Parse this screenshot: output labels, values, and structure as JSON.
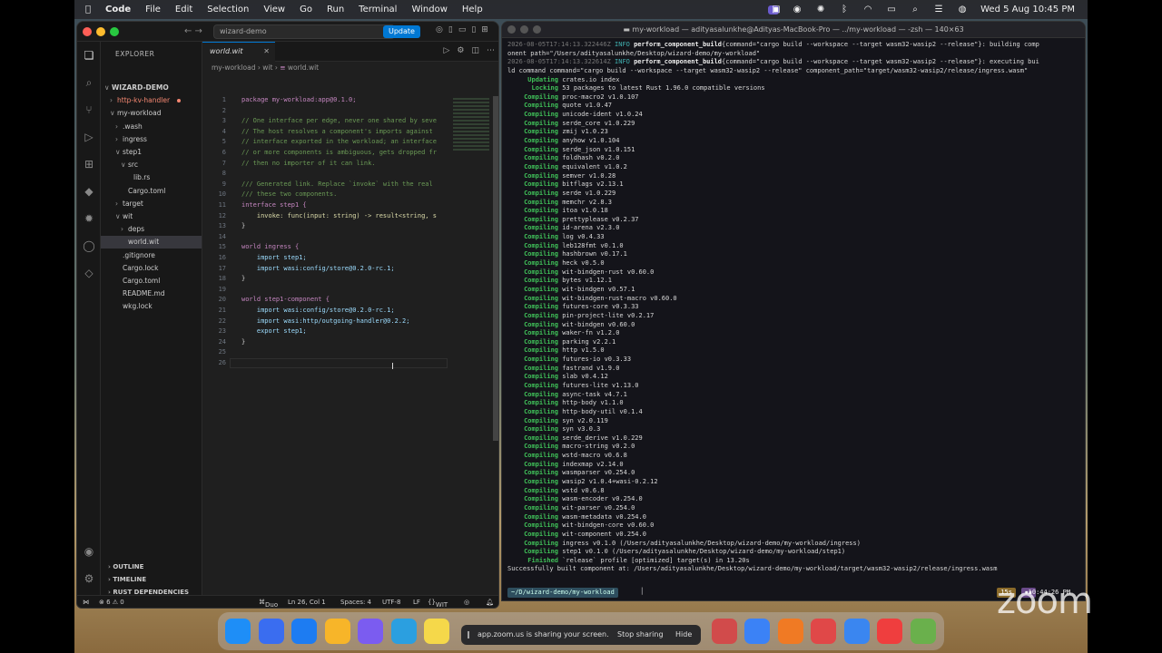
{
  "menubar": {
    "items": [
      "Code",
      "File",
      "Edit",
      "Selection",
      "View",
      "Go",
      "Run",
      "Terminal",
      "Window",
      "Help"
    ],
    "datetime": "Wed 5 Aug  10:45 PM"
  },
  "vscode": {
    "search": "wizard-demo",
    "update_label": "Update",
    "explorer_header": "EXPLORER",
    "tab_label": "world.wit",
    "breadcrumb": [
      "my-workload",
      "wit",
      "world.wit"
    ],
    "tree": [
      {
        "label": "WIZARD-DEMO",
        "depth": 0,
        "chev": "∨"
      },
      {
        "label": "http-kv-handler",
        "depth": 1,
        "chev": "›",
        "red": true
      },
      {
        "label": "my-workload",
        "depth": 1,
        "chev": "∨"
      },
      {
        "label": ".wash",
        "depth": 2,
        "chev": "›"
      },
      {
        "label": "ingress",
        "depth": 2,
        "chev": "›"
      },
      {
        "label": "step1",
        "depth": 2,
        "chev": "∨"
      },
      {
        "label": "src",
        "depth": 3,
        "chev": "∨"
      },
      {
        "label": "lib.rs",
        "depth": 4,
        "chev": ""
      },
      {
        "label": "Cargo.toml",
        "depth": 3,
        "chev": ""
      },
      {
        "label": "target",
        "depth": 2,
        "chev": "›"
      },
      {
        "label": "wit",
        "depth": 2,
        "chev": "∨"
      },
      {
        "label": "deps",
        "depth": 3,
        "chev": "›"
      },
      {
        "label": "world.wit",
        "depth": 3,
        "chev": "",
        "selected": true
      },
      {
        "label": ".gitignore",
        "depth": 2,
        "chev": ""
      },
      {
        "label": "Cargo.lock",
        "depth": 2,
        "chev": ""
      },
      {
        "label": "Cargo.toml",
        "depth": 2,
        "chev": ""
      },
      {
        "label": "README.md",
        "depth": 2,
        "chev": ""
      },
      {
        "label": "wkg.lock",
        "depth": 2,
        "chev": ""
      }
    ],
    "sections": [
      "OUTLINE",
      "TIMELINE",
      "RUST DEPENDENCIES"
    ],
    "code": [
      "package my-workload:app@0.1.0;",
      "",
      "// One interface per edge, never one shared by seve",
      "// The host resolves a component's imports against",
      "// interface exported in the workload; an interface",
      "// or more components is ambiguous, gets dropped fr",
      "// then no importer of it can link.",
      "",
      "/// Generated link. Replace `invoke` with the real",
      "/// these two components.",
      "interface step1 {",
      "    invoke: func(input: string) -> result<string, s",
      "}",
      "",
      "world ingress {",
      "    import step1;",
      "    import wasi:config/store@0.2.0-rc.1;",
      "}",
      "",
      "world step1-component {",
      "    import wasi:config/store@0.2.0-rc.1;",
      "    import wasi:http/outgoing-handler@0.2.2;",
      "    export step1;",
      "}",
      "",
      ""
    ],
    "status": {
      "problems": "⊗ 6 ⚠ 0",
      "duo": "Duo",
      "position": "Ln 26, Col 1",
      "spaces": "Spaces: 4",
      "encoding": "UTF-8",
      "eol": "LF",
      "lang": "WIT"
    }
  },
  "terminal": {
    "title": "my-workload — adityasalunkhe@Adityas-MacBook-Pro — ../my-workload — -zsh — 140×63",
    "header_lines": [
      {
        "ts": "2026-08-05T17:14:13.322446Z",
        "level": "INFO",
        "fn": "perform_component_build",
        "rest": "{command=\"cargo build --workspace --target wasm32-wasip2 --release\"}: building comp"
      },
      {
        "ts": "",
        "level": "",
        "fn": "",
        "rest": "onent path=\"/Users/adityasalunkhe/Desktop/wizard-demo/my-workload\""
      },
      {
        "ts": "2026-08-05T17:14:13.322614Z",
        "level": "INFO",
        "fn": "perform_component_build",
        "rest": "{command=\"cargo build --workspace --target wasm32-wasip2 --release\"}: executing bui"
      },
      {
        "ts": "",
        "level": "",
        "fn": "",
        "rest": "ld command command=\"cargo build --workspace --target wasm32-wasip2 --release\" component_path=\"target/wasm32-wasip2/release/ingress.wasm\""
      }
    ],
    "cargo_lines": [
      [
        "Updating",
        "crates.io index"
      ],
      [
        "Locking",
        "53 packages to latest Rust 1.96.0 compatible versions"
      ],
      [
        "Compiling",
        "proc-macro2 v1.0.107"
      ],
      [
        "Compiling",
        "quote v1.0.47"
      ],
      [
        "Compiling",
        "unicode-ident v1.0.24"
      ],
      [
        "Compiling",
        "serde_core v1.0.229"
      ],
      [
        "Compiling",
        "zmij v1.0.23"
      ],
      [
        "Compiling",
        "anyhow v1.0.104"
      ],
      [
        "Compiling",
        "serde_json v1.0.151"
      ],
      [
        "Compiling",
        "foldhash v0.2.0"
      ],
      [
        "Compiling",
        "equivalent v1.0.2"
      ],
      [
        "Compiling",
        "semver v1.0.28"
      ],
      [
        "Compiling",
        "bitflags v2.13.1"
      ],
      [
        "Compiling",
        "serde v1.0.229"
      ],
      [
        "Compiling",
        "memchr v2.8.3"
      ],
      [
        "Compiling",
        "itoa v1.0.18"
      ],
      [
        "Compiling",
        "prettyplease v0.2.37"
      ],
      [
        "Compiling",
        "id-arena v2.3.0"
      ],
      [
        "Compiling",
        "log v0.4.33"
      ],
      [
        "Compiling",
        "leb128fmt v0.1.0"
      ],
      [
        "Compiling",
        "hashbrown v0.17.1"
      ],
      [
        "Compiling",
        "heck v0.5.0"
      ],
      [
        "Compiling",
        "wit-bindgen-rust v0.60.0"
      ],
      [
        "Compiling",
        "bytes v1.12.1"
      ],
      [
        "Compiling",
        "wit-bindgen v0.57.1"
      ],
      [
        "Compiling",
        "wit-bindgen-rust-macro v0.60.0"
      ],
      [
        "Compiling",
        "futures-core v0.3.33"
      ],
      [
        "Compiling",
        "pin-project-lite v0.2.17"
      ],
      [
        "Compiling",
        "wit-bindgen v0.60.0"
      ],
      [
        "Compiling",
        "waker-fn v1.2.0"
      ],
      [
        "Compiling",
        "parking v2.2.1"
      ],
      [
        "Compiling",
        "http v1.5.0"
      ],
      [
        "Compiling",
        "futures-io v0.3.33"
      ],
      [
        "Compiling",
        "fastrand v1.9.0"
      ],
      [
        "Compiling",
        "slab v0.4.12"
      ],
      [
        "Compiling",
        "futures-lite v1.13.0"
      ],
      [
        "Compiling",
        "async-task v4.7.1"
      ],
      [
        "Compiling",
        "http-body v1.1.0"
      ],
      [
        "Compiling",
        "http-body-util v0.1.4"
      ],
      [
        "Compiling",
        "syn v2.0.119"
      ],
      [
        "Compiling",
        "syn v3.0.3"
      ],
      [
        "Compiling",
        "serde_derive v1.0.229"
      ],
      [
        "Compiling",
        "macro-string v0.2.0"
      ],
      [
        "Compiling",
        "wstd-macro v0.6.8"
      ],
      [
        "Compiling",
        "indexmap v2.14.0"
      ],
      [
        "Compiling",
        "wasmparser v0.254.0"
      ],
      [
        "Compiling",
        "wasip2 v1.0.4+wasi-0.2.12"
      ],
      [
        "Compiling",
        "wstd v0.6.8"
      ],
      [
        "Compiling",
        "wasm-encoder v0.254.0"
      ],
      [
        "Compiling",
        "wit-parser v0.254.0"
      ],
      [
        "Compiling",
        "wasm-metadata v0.254.0"
      ],
      [
        "Compiling",
        "wit-bindgen-core v0.60.0"
      ],
      [
        "Compiling",
        "wit-component v0.254.0"
      ],
      [
        "Compiling",
        "ingress v0.1.0 (/Users/adityasalunkhe/Desktop/wizard-demo/my-workload/ingress)"
      ],
      [
        "Compiling",
        "step1 v0.1.0 (/Users/adityasalunkhe/Desktop/wizard-demo/my-workload/step1)"
      ],
      [
        "Finished",
        "`release` profile [optimized] target(s) in 13.20s"
      ]
    ],
    "success_line": "Successfully built component at: /Users/adityasalunkhe/Desktop/wizard-demo/my-workload/target/wasm32-wasip2/release/ingress.wasm",
    "prompt_path": "~/D/wizard-demo/my-workload",
    "prompt_duration": "15s",
    "prompt_time": "10:44:26 PM"
  },
  "zoom": {
    "share_msg": "app.zoom.us is sharing your screen.",
    "stop_label": "Stop sharing",
    "hide_label": "Hide",
    "logo": "zoom"
  },
  "dock_colors": [
    "#1e8ef7",
    "#3a6df0",
    "#1d7cf2",
    "#f7b529",
    "#7b5cf0",
    "#2b9fe0",
    "#f5d84a",
    "#d14b4b",
    "#3b82f6",
    "#f07a24",
    "#e04848",
    "#3a86f0",
    "#ef3e3e",
    "#6ab04c",
    "#2d8cf0",
    "#c0c0c0"
  ]
}
